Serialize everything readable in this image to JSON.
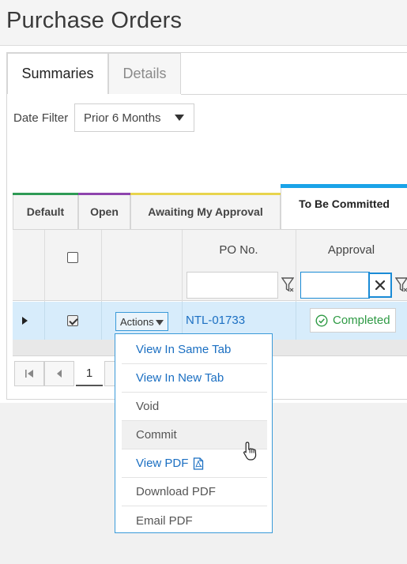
{
  "page": {
    "title": "Purchase Orders"
  },
  "tabs": [
    {
      "label": "Summaries",
      "active": true
    },
    {
      "label": "Details",
      "active": false
    }
  ],
  "filter": {
    "label": "Date Filter",
    "value": "Prior 6 Months"
  },
  "view_tabs": [
    {
      "label": "Default",
      "color": "#2e9a55"
    },
    {
      "label": "Open",
      "color": "#8e44ad"
    },
    {
      "label": "Awaiting My Approval",
      "color": "#e8d44d"
    },
    {
      "label": "To Be Committed",
      "color": "#1aa3e8",
      "active": true
    }
  ],
  "grid": {
    "columns": [
      {
        "label": ""
      },
      {
        "label": ""
      },
      {
        "label": ""
      },
      {
        "label": "PO No."
      },
      {
        "label": "Approval"
      }
    ],
    "rows": [
      {
        "selected": true,
        "actions_label": "Actions",
        "po_no": "NTL-01733",
        "approval": "Completed"
      }
    ]
  },
  "pager": {
    "current_page": "1"
  },
  "actions_menu": {
    "items": [
      {
        "label": "View In Same Tab",
        "style": "link"
      },
      {
        "label": "View In New Tab",
        "style": "link"
      },
      {
        "label": "Void",
        "style": "plain"
      },
      {
        "label": "Commit",
        "style": "plain",
        "hovered": true
      },
      {
        "label": "View PDF",
        "style": "link",
        "icon": "pdf-icon"
      },
      {
        "label": "Download PDF",
        "style": "plain"
      },
      {
        "label": "Email PDF",
        "style": "plain"
      }
    ]
  },
  "colors": {
    "accent": "#1aa3e8",
    "link": "#1b6fc2",
    "success": "#2e9a44",
    "row_selected": "#d7ecfb"
  }
}
